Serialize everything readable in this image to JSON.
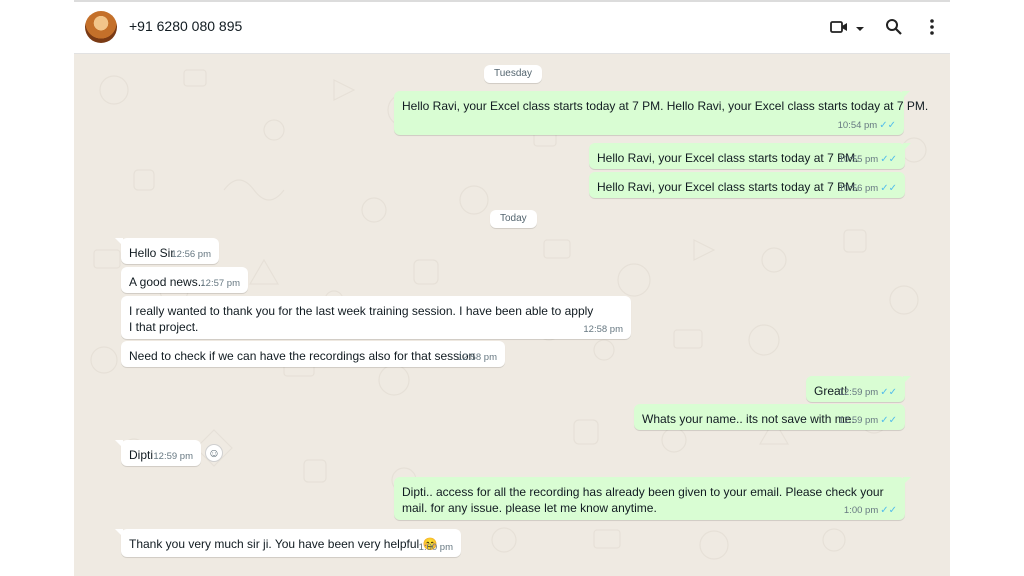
{
  "header": {
    "contact": "+91 6280 080 895",
    "icons": [
      "avatar",
      "video-call-icon",
      "chevron-down-icon",
      "search-icon",
      "more-options-icon"
    ]
  },
  "dates": {
    "tuesday": "Tuesday",
    "today": "Today"
  },
  "messages": {
    "m1": {
      "text": "Hello Ravi, your Excel class starts today at 7 PM. Hello Ravi, your Excel class starts today at 7 PM.",
      "time": "10:54 pm",
      "tick": "✓✓"
    },
    "m2": {
      "text": "Hello Ravi, your Excel class starts today at 7 PM.",
      "time": "10:55 pm",
      "tick": "✓✓"
    },
    "m3": {
      "text": "Hello Ravi, your Excel class starts today at 7 PM.",
      "time": "10:56 pm",
      "tick": "✓✓"
    },
    "m4": {
      "text": "Hello Sir",
      "time": "12:56 pm"
    },
    "m5": {
      "text": "A good news..",
      "time": "12:57 pm"
    },
    "m6": {
      "text": "I really wanted to thank you for the last week training session. I have been able to apply I that project.",
      "time": "12:58 pm"
    },
    "m7": {
      "text": "Need to check if we can have the recordings also for that session",
      "time": "12:58 pm"
    },
    "m8": {
      "text": "Great!",
      "time": "12:59 pm",
      "tick": "✓✓"
    },
    "m9": {
      "text": "Whats your name.. its not save with me.",
      "time": "12:59 pm",
      "tick": "✓✓"
    },
    "m10": {
      "text": "Dipti",
      "time": "12:59 pm"
    },
    "m11": {
      "text": "Dipti.. access for all the recording has already been given to your email. Please check your mail. for any issue. please let me know anytime.",
      "time": "1:00 pm",
      "tick": "✓✓"
    },
    "m12": {
      "text": "Thank you very much sir ji. You have been very helpful 😊",
      "time": "1:00 pm"
    }
  },
  "colors": {
    "chat_bg": "#efeae2",
    "incoming": "#ffffff",
    "outgoing": "#d9fdd3",
    "tick": "#53bdeb"
  }
}
